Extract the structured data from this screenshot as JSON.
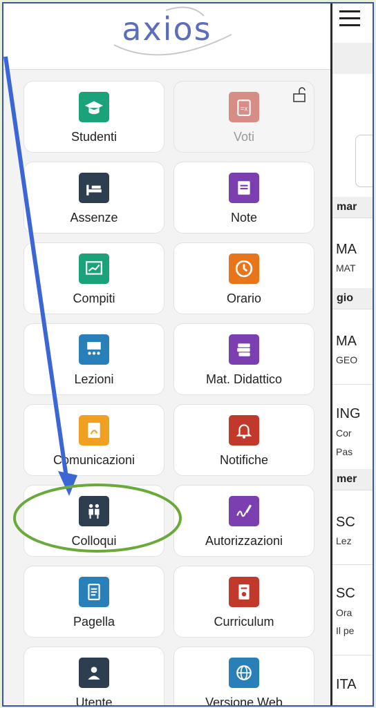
{
  "app": {
    "logo": "axios"
  },
  "menu": [
    {
      "label": "Studenti",
      "icon": "graduation-cap-icon",
      "color": "#1aa37b"
    },
    {
      "label": "Voti",
      "icon": "clipboard-icon",
      "color": "#c0392b",
      "locked": true
    },
    {
      "label": "Assenze",
      "icon": "bed-icon",
      "color": "#2c3e50"
    },
    {
      "label": "Note",
      "icon": "note-icon",
      "color": "#7b3fb0"
    },
    {
      "label": "Compiti",
      "icon": "chart-board-icon",
      "color": "#1aa37b"
    },
    {
      "label": "Orario",
      "icon": "clock-icon",
      "color": "#e8751a"
    },
    {
      "label": "Lezioni",
      "icon": "classroom-icon",
      "color": "#2980b9"
    },
    {
      "label": "Mat. Didattico",
      "icon": "books-icon",
      "color": "#7b3fb0"
    },
    {
      "label": "Comunicazioni",
      "icon": "pdf-file-icon",
      "color": "#f0a020"
    },
    {
      "label": "Notifiche",
      "icon": "bell-icon",
      "color": "#c0392b"
    },
    {
      "label": "Colloqui",
      "icon": "people-icon",
      "color": "#2c3e50"
    },
    {
      "label": "Autorizzazioni",
      "icon": "signature-icon",
      "color": "#7b3fb0"
    },
    {
      "label": "Pagella",
      "icon": "report-card-icon",
      "color": "#2980b9"
    },
    {
      "label": "Curriculum",
      "icon": "certificate-icon",
      "color": "#c0392b"
    },
    {
      "label": "Utente",
      "icon": "user-icon",
      "color": "#2c3e50"
    },
    {
      "label": "Versione Web",
      "icon": "globe-icon",
      "color": "#2980b9"
    }
  ],
  "main": {
    "days": [
      {
        "day": "mar",
        "entries": [
          {
            "title": "MA",
            "lines": [
              "MAT"
            ]
          }
        ]
      },
      {
        "day": "gio",
        "entries": [
          {
            "title": "MA",
            "lines": [
              "GEO"
            ]
          },
          {
            "title": "ING",
            "lines": [
              "Cor",
              "Pas"
            ]
          }
        ]
      },
      {
        "day": "mer",
        "entries": [
          {
            "title": "SC",
            "lines": [
              "Lez"
            ]
          },
          {
            "title": "SC",
            "lines": [
              "Ora",
              "Il pe"
            ]
          },
          {
            "title": "ITA",
            "lines": []
          }
        ]
      }
    ]
  },
  "annotation": {
    "arrow_color": "#3a66d6",
    "circle_color": "#6aaa3a",
    "highlight": "Colloqui"
  }
}
